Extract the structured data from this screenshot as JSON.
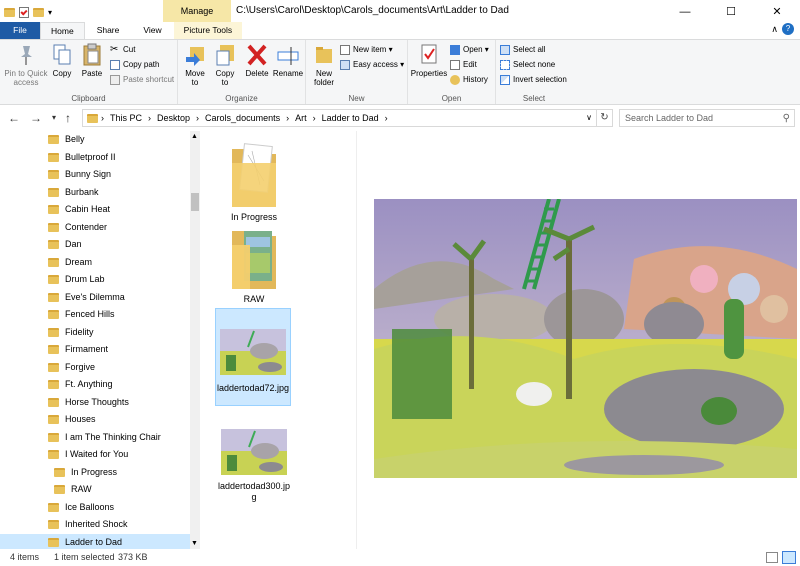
{
  "window": {
    "title_path": "C:\\Users\\Carol\\Desktop\\Carols_documents\\Art\\Ladder to Dad",
    "context_tab_group": "Manage",
    "minimize": "—",
    "maximize": "☐",
    "close": "✕"
  },
  "tabs": {
    "file": "File",
    "home": "Home",
    "share": "Share",
    "view": "View",
    "picture_tools": "Picture Tools"
  },
  "ribbon": {
    "clipboard": {
      "group": "Clipboard",
      "pin": "Pin to Quick access",
      "copy": "Copy",
      "paste": "Paste",
      "cut": "Cut",
      "copy_path": "Copy path",
      "paste_shortcut": "Paste shortcut"
    },
    "organize": {
      "group": "Organize",
      "move_to": "Move to",
      "copy_to": "Copy to",
      "delete": "Delete",
      "rename": "Rename"
    },
    "new": {
      "group": "New",
      "new_folder": "New folder",
      "new_item": "New item ▾",
      "easy_access": "Easy access ▾"
    },
    "open": {
      "group": "Open",
      "properties": "Properties",
      "open": "Open ▾",
      "edit": "Edit",
      "history": "History"
    },
    "select": {
      "group": "Select",
      "select_all": "Select all",
      "select_none": "Select none",
      "invert": "Invert selection"
    }
  },
  "address": {
    "crumbs": [
      "This PC",
      "Desktop",
      "Carols_documents",
      "Art",
      "Ladder to Dad"
    ],
    "search_placeholder": "Search Ladder to Dad"
  },
  "nav_items": [
    "Belly",
    "Bulletproof II",
    "Bunny Sign",
    "Burbank",
    "Cabin Heat",
    "Contender",
    "Dan",
    "Dream",
    "Drum Lab",
    "Eve's Dilemma",
    "Fenced Hills",
    "Fidelity",
    "Firmament",
    "Forgive",
    "Ft. Anything",
    "Horse Thoughts",
    "Houses",
    "I am The Thinking Chair",
    "I Waited for You",
    "In Progress",
    "RAW",
    "Ice Balloons",
    "Inherited Shock",
    "Ladder to Dad"
  ],
  "files": [
    "In Progress",
    "RAW",
    "laddertodad72.jpg",
    "laddertodad300.jpg"
  ],
  "status": {
    "items": "4 items",
    "selected": "1 item selected",
    "size": "373 KB"
  },
  "colors": {
    "file_tab": "#1f5ba5",
    "selection": "#cce8ff",
    "manage_tab": "#f6e7a7",
    "folder": "#e8c25a"
  }
}
